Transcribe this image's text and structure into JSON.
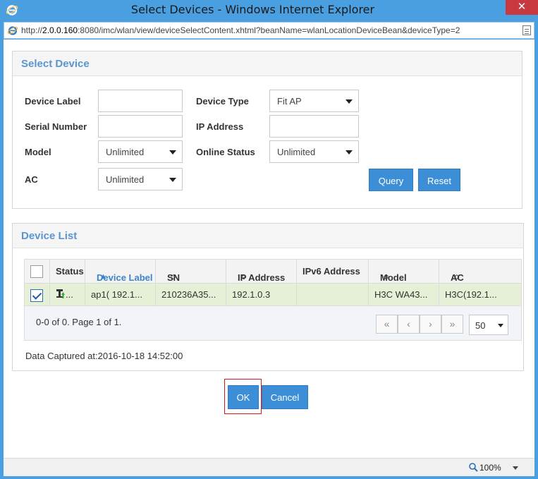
{
  "window": {
    "title": "Select Devices - Windows Internet Explorer",
    "close_glyph": "✕",
    "address_prefix": "http://",
    "address_host": "2.0.0.160",
    "address_rest": ":8080/imc/wlan/view/deviceSelectContent.xhtml?beanName=wlanLocationDeviceBean&deviceType=2",
    "zoom": "100%",
    "icons": {
      "browser": "internet-explorer-icon",
      "zoom": "magnifier-icon"
    },
    "colors": {
      "chrome": "#4a9fe0",
      "close": "#c7383f",
      "accent": "#3c8fd7",
      "link": "#5a95cf",
      "selected_row": "#e6f0d6",
      "focus_outline": "#d11b1b"
    }
  },
  "filter": {
    "title": "Select Device",
    "device_label": {
      "label": "Device Label",
      "value": ""
    },
    "device_type": {
      "label": "Device Type",
      "value": "Fit AP"
    },
    "serial_number": {
      "label": "Serial Number",
      "value": ""
    },
    "ip_address": {
      "label": "IP Address",
      "value": ""
    },
    "model": {
      "label": "Model",
      "value": "Unlimited"
    },
    "online_status": {
      "label": "Online Status",
      "value": "Unlimited"
    },
    "ac": {
      "label": "AC",
      "value": "Unlimited"
    },
    "query_label": "Query",
    "reset_label": "Reset"
  },
  "list": {
    "title": "Device List",
    "columns": {
      "status": "Status",
      "device_label": "Device Label",
      "sn": "SN",
      "ip_address": "IP Address",
      "ipv6_address": "IPv6 Address",
      "model": "Model",
      "ac": "AC"
    },
    "sort_glyph": "≎",
    "rows": [
      {
        "checked": true,
        "status_icon": "ap-online-icon",
        "status_text": "...",
        "device_label": "ap1( 192.1...",
        "sn": "210236A35...",
        "ip_address": "192.1.0.3",
        "ipv6_address": "",
        "model": "H3C WA43...",
        "ac": "H3C(192.1..."
      }
    ],
    "pager_text": "0-0 of 0. Page 1 of 1.",
    "pager_buttons": {
      "first": "«",
      "prev": "‹",
      "next": "›",
      "last": "»"
    },
    "page_size": "50",
    "captured": "Data Captured at:2016-10-18 14:52:00"
  },
  "dialog": {
    "ok_label": "OK",
    "cancel_label": "Cancel"
  }
}
